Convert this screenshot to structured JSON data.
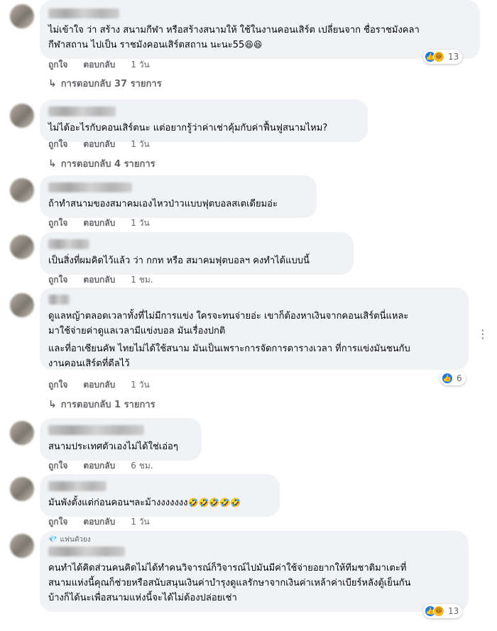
{
  "labels": {
    "like": "ถูกใจ",
    "reply": "ตอบกลับ"
  },
  "colors": {
    "like": "#1877f2",
    "haha": "#f7b928",
    "bubble": "#f0f2f5",
    "meta": "#65676b"
  },
  "more_icon": "⋮",
  "comments": [
    {
      "text": "ไม่เข้าใจ ว่า สร้าง สนามกีฬา หรือสร้างสนามให้ ใช้ในงานคอนเสิร์ต เปลี่ยนจาก ชื่อราชมังคลา\nกีฬาสถาน ไปเป็น ราชมังคอนเสิร์ตสถาน นะนะ55",
      "emoji": "😆😆",
      "time": "1 วัน",
      "reaction_count": "13",
      "reactions": [
        "like",
        "haha"
      ],
      "replies": "การตอบกลับ 37 รายการ"
    },
    {
      "text": "ไม่ได้อะไรกับคอนเสิร์ตนะ แต่อยากรู้ว่าค่าเช่าคุ้มกับค่าฟื้นฟูสนามไหม?",
      "time": "1 วัน",
      "replies": "การตอบกลับ 4 รายการ"
    },
    {
      "text": "ถ้าทำสนามของสมาคมเองไหวป่าวแบบฟุตบอลสเตเดียมอ่ะ",
      "time": "1 วัน"
    },
    {
      "text": "เป็นสิ่งที่ผมคิดไว้แล้ว ว่า กกท หรือ สมาคมฟุตบอลฯ คงทำได้แบบนี้",
      "time": "1 ชม."
    },
    {
      "text": "ดูแลหญ้าตลอดเวลาทั้งที่ไม่มีการแข่ง ใครจะทนจ่ายอ่ะ เขาก็ต้องหาเงินจากคอนเสิร์ตนี่แหละ\nมาใช้จ่ายค่าดูแลเวลามีแข่งบอล มันเรื่องปกติ",
      "text2": "และที่อาเซียนคัพ ไทยไม่ได้ใช้สนาม มันเป็นเพราะการจัดการตารางเวลา ที่การแข่งมันชนกับ\nงานคอนเสิร์ตที่ตีลไว้",
      "time": "1 วัน",
      "reaction_count": "6",
      "reactions": [
        "like"
      ],
      "replies": "การตอบกลับ 1 รายการ"
    },
    {
      "text": "สนามประเทศตัวเองไม่ได้ใช่เอ่อๆ",
      "time": "6 ชม."
    },
    {
      "text": "มันพังตั้งแต่ก่อนคอนฯละม้างงงงงงง",
      "emoji": "🤣🤣🤣🤣🤣",
      "time": "1 วัน"
    },
    {
      "badge": "แฟนตัวยง",
      "text": "คนทำได้คิดส่วนคนคิดไม่ได้ทำคนวิจารณ์ก็วิจารณ์ไปมันมีค่าใช้จ่ายอยากให้ทีมชาติมาเตะที่\nสนามแห่งนี้คุณก็ช่วยหรือสนับสนุนเงินค่าบำรุงดูแลรักษาจากเงินค่าเหล้าค่าเบียร์หลังตู้เย็นกัน\nบ้างก็ได้นะเพื่อสนามแห่งนี้จะได้ไม่ต้องปล่อยเช่า",
      "reaction_count": "13",
      "reactions": [
        "like",
        "haha"
      ]
    }
  ]
}
